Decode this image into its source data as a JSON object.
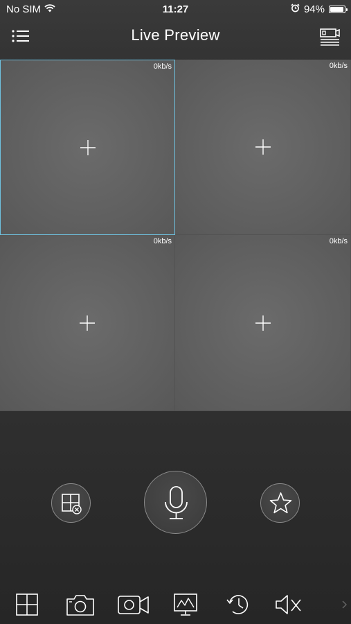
{
  "status_bar": {
    "carrier": "No SIM",
    "time": "11:27",
    "battery_percent": "94%",
    "battery_level": 0.94
  },
  "header": {
    "title": "Live Preview"
  },
  "video_cells": [
    {
      "rate": "0kb/s",
      "selected": true
    },
    {
      "rate": "0kb/s",
      "selected": false
    },
    {
      "rate": "0kb/s",
      "selected": false
    },
    {
      "rate": "0kb/s",
      "selected": false
    }
  ],
  "colors": {
    "selection_border": "#6fc2e0",
    "icon": "#ffffff"
  },
  "controls": {
    "left_icon": "close-window-icon",
    "center_icon": "microphone-icon",
    "right_icon": "star-icon"
  },
  "toolbar": {
    "icons": [
      "split-screen-icon",
      "camera-icon",
      "video-record-icon",
      "monitor-icon",
      "playback-icon",
      "mute-icon",
      "chevron-right-icon"
    ]
  }
}
